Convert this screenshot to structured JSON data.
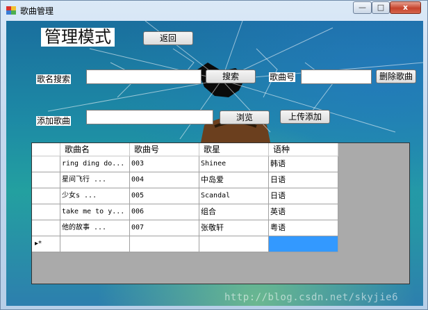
{
  "window": {
    "title": "歌曲管理",
    "min_label": "—",
    "max_label": "□",
    "close_label": "x"
  },
  "admin": {
    "mode_label": "管理模式",
    "back_label": "返回"
  },
  "search": {
    "label": "歌名搜索",
    "value": "",
    "button": "搜索"
  },
  "delete": {
    "label": "歌曲号",
    "value": "",
    "button": "删除歌曲"
  },
  "add": {
    "label": "添加歌曲",
    "value": "",
    "browse": "浏览",
    "upload": "上传添加"
  },
  "grid": {
    "columns": [
      "歌曲名",
      "歌曲号",
      "歌星",
      "语种"
    ],
    "rows": [
      [
        "ring ding do...",
        "003",
        "Shinee",
        "韩语"
      ],
      [
        "星间飞行      ...",
        "004",
        "中岛爱",
        "日语"
      ],
      [
        "少女s        ...",
        "005",
        "Scandal",
        "日语"
      ],
      [
        "take me to y...",
        "006",
        "组合",
        "英语"
      ],
      [
        "他的故事      ...",
        "007",
        "张敬轩",
        "粤语"
      ]
    ],
    "new_row_marker": "▸*"
  },
  "watermark": "http://blog.csdn.net/skyjie6",
  "colors": {
    "selection": "#3399ff",
    "close_button": "#c6432c"
  }
}
